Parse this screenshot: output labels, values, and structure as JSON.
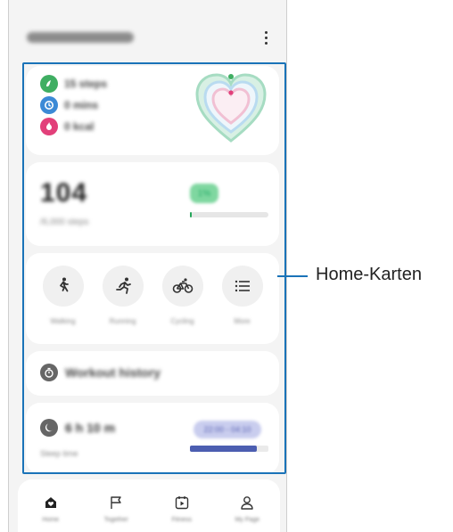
{
  "header": {
    "title": "Samsung Health",
    "more_icon": "more-vert-icon"
  },
  "callout": {
    "label": "Home-Karten"
  },
  "activity_card": {
    "metrics": [
      {
        "icon": "steps-icon",
        "color": "#3fae62",
        "value": "15 steps"
      },
      {
        "icon": "clock-icon",
        "color": "#3c8ad6",
        "value": "0 mins"
      },
      {
        "icon": "flame-icon",
        "color": "#e2407a",
        "value": "0 kcal"
      }
    ]
  },
  "steps_card": {
    "count": "104",
    "goal": "/6,000 steps",
    "percent_label": "1%",
    "progress_fraction": 0.02,
    "accent": "#26a65b"
  },
  "exercise_card": {
    "items": [
      {
        "label": "Walking",
        "icon": "walking-icon"
      },
      {
        "label": "Running",
        "icon": "running-icon"
      },
      {
        "label": "Cycling",
        "icon": "cycling-icon"
      },
      {
        "label": "More",
        "icon": "list-icon"
      }
    ]
  },
  "workout_card": {
    "label": "Workout history",
    "icon": "stopwatch-icon"
  },
  "sleep_card": {
    "value": "6 h 10 m",
    "label": "Sleep time",
    "range": "22:00 - 04:10",
    "progress_fraction": 0.85,
    "accent": "#4c5eb1"
  },
  "bottom_nav": {
    "items": [
      {
        "label": "Home",
        "icon": "home-icon"
      },
      {
        "label": "Together",
        "icon": "flag-icon"
      },
      {
        "label": "Fitness",
        "icon": "fitness-icon"
      },
      {
        "label": "My Page",
        "icon": "person-icon"
      }
    ]
  }
}
